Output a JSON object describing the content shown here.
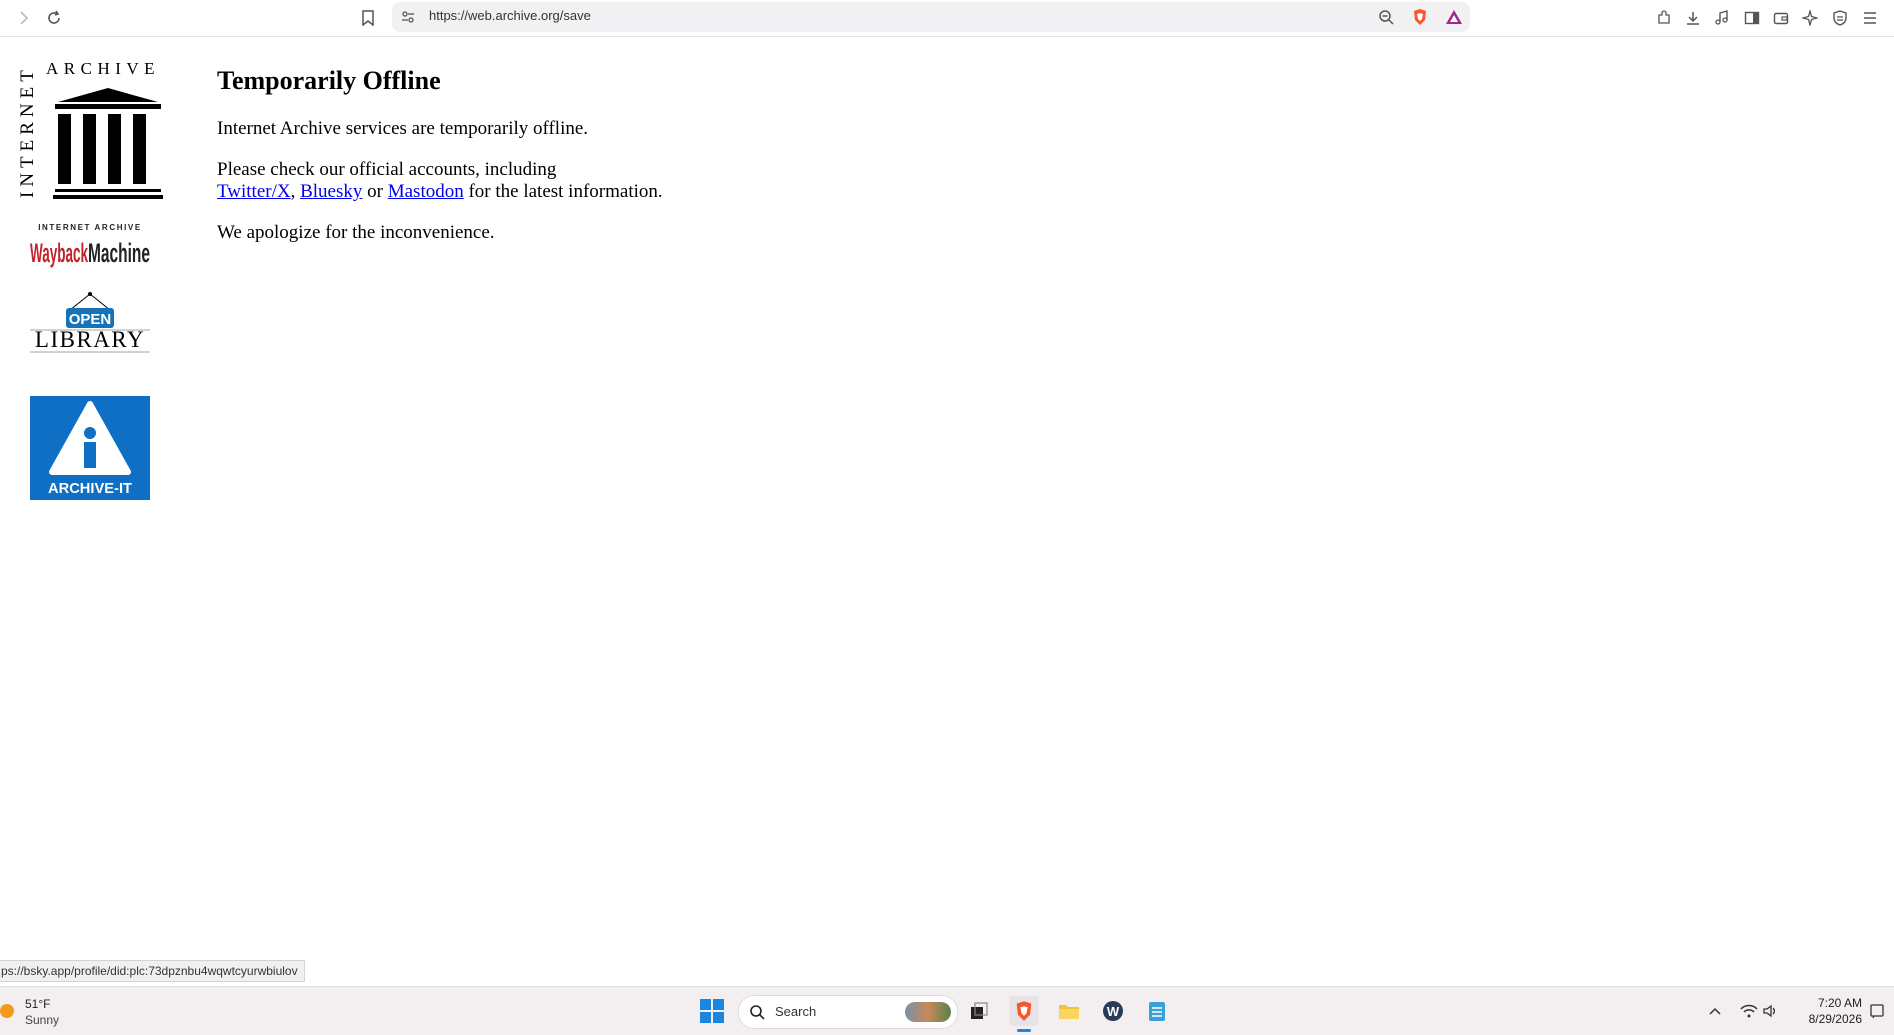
{
  "browser": {
    "url": "https://web.archive.org/save",
    "status_link": "ps://bsky.app/profile/did:plc:73dpznbu4wqwtcyurwbiulov"
  },
  "sidebar_logos": {
    "ia_word_vertical": "INTERNET",
    "ia_word_top": "ARCHIVE",
    "wayback_top": "INTERNET ARCHIVE",
    "wayback_main": "WaybackMachine",
    "openlibrary_sign": "OPEN",
    "openlibrary_text": "LIBRARY",
    "archiveit_text": "ARCHIVE-IT"
  },
  "page": {
    "title": "Temporarily Offline",
    "para1": "Internet Archive services are temporarily offline.",
    "para2_prefix": "Please check our official accounts, including",
    "link_twitter": "Twitter/X",
    "comma": ",",
    "link_bluesky": "Bluesky",
    "or": "or",
    "link_mastodon": "Mastodon",
    "para2_suffix": "for the latest information.",
    "para3": "We apologize for the inconvenience."
  },
  "taskbar": {
    "weather_temp": "51°F",
    "weather_desc": "Sunny",
    "search_label": "Search",
    "time": "7:20 AM",
    "date": "8/29/2026"
  },
  "colors": {
    "link": "#0000ee",
    "brave_orange": "#fb542b",
    "archiveit_blue": "#0e6fc4",
    "wayback_red": "#c0232b",
    "start_blue": "#1a86e0"
  }
}
